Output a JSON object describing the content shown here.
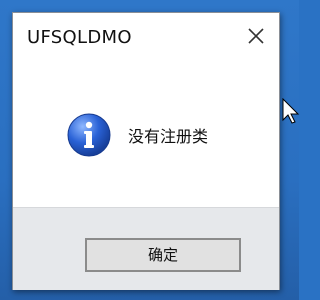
{
  "window": {
    "title": "UFSQLDMO",
    "close_icon": "close-icon"
  },
  "dialog": {
    "icon": "info-icon",
    "message": "没有注册类",
    "ok_label": "确定"
  },
  "colors": {
    "desktop": "#2a72c4",
    "dialog_bg": "#ffffff",
    "footer_bg": "#e6e8eb",
    "icon_blue": "#1f56c8"
  }
}
